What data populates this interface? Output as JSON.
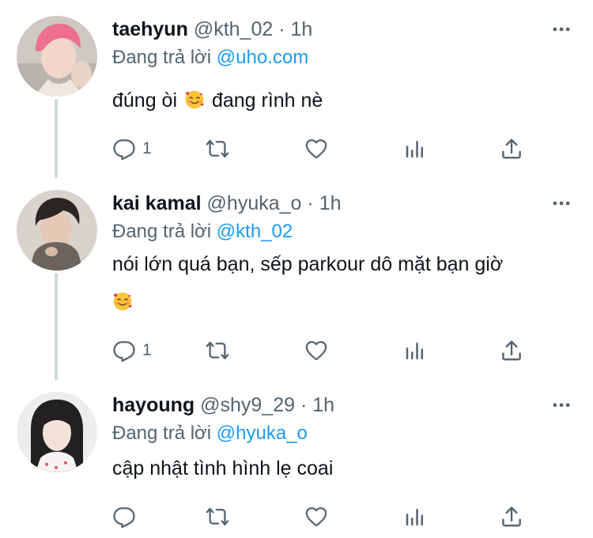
{
  "replying_to_label": "Đang trả lời",
  "accent_color": "#1d9bf0",
  "tweets": [
    {
      "name": "taehyun",
      "handle": "@kth_02",
      "separator": "·",
      "time": "1h",
      "replying_to": "@uho.com",
      "text_before_emoji": "đúng òi",
      "emoji": "smiling-face-with-hearts",
      "text_after_emoji": "đang rình nè",
      "reply_count": "1",
      "avatar": "pink-haired-person-avatar"
    },
    {
      "name": "kai kamal",
      "handle": "@hyuka_o",
      "separator": "·",
      "time": "1h",
      "replying_to": "@kth_02",
      "text_line1": "nói lớn quá bạn, sếp parkour dô mặt bạn giờ",
      "emoji": "smiling-face-with-hearts",
      "reply_count": "1",
      "avatar": "dark-haired-person-avatar"
    },
    {
      "name": "hayoung",
      "handle": "@shy9_29",
      "separator": "·",
      "time": "1h",
      "replying_to": "@hyuka_o",
      "text": "cập nhật tình hình lẹ coai",
      "reply_count": "",
      "avatar": "long-haired-person-avatar"
    }
  ]
}
